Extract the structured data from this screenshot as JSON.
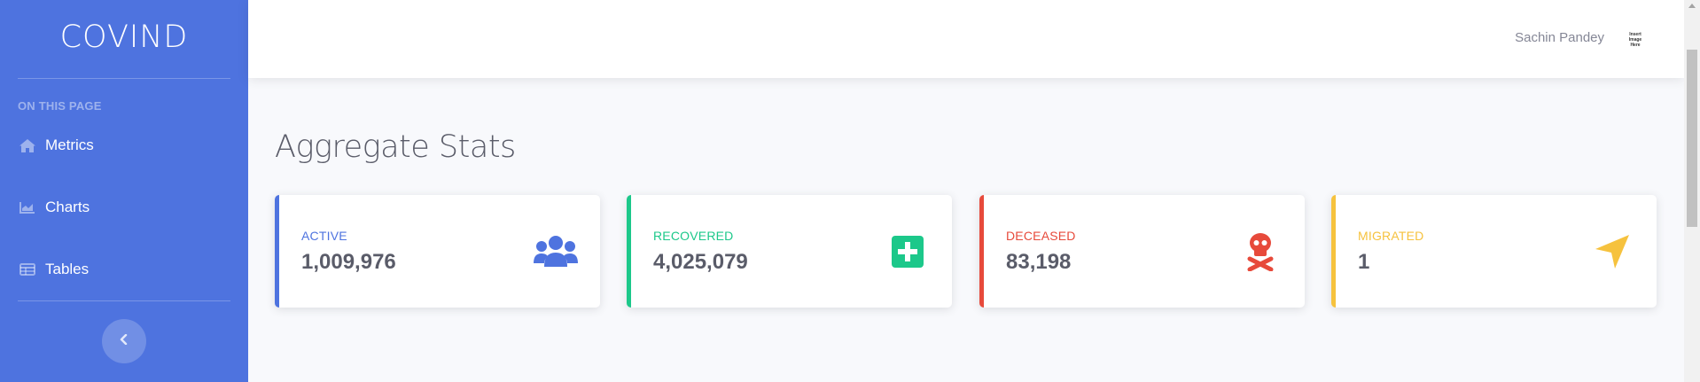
{
  "sidebar": {
    "brand": "COVIND",
    "section_heading": "ON THIS PAGE",
    "items": [
      {
        "label": "Metrics",
        "icon": "home-icon"
      },
      {
        "label": "Charts",
        "icon": "area-chart-icon"
      },
      {
        "label": "Tables",
        "icon": "table-icon"
      }
    ],
    "toggle_icon": "chevron-left-icon",
    "background_color": "#4e73df"
  },
  "topbar": {
    "user_name": "Sachin Pandey",
    "avatar_text": [
      "Insert",
      "Image",
      "Here"
    ]
  },
  "main": {
    "page_title": "Aggregate Stats",
    "cards": [
      {
        "label": "ACTIVE",
        "value": "1,009,976",
        "color": "#4e73df",
        "icon": "users-icon"
      },
      {
        "label": "RECOVERED",
        "value": "4,025,079",
        "color": "#1cc88a",
        "icon": "plus-square-icon"
      },
      {
        "label": "DECEASED",
        "value": "83,198",
        "color": "#e74a3b",
        "icon": "skull-crossbones-icon"
      },
      {
        "label": "MIGRATED",
        "value": "1",
        "color": "#f6c23e",
        "icon": "location-arrow-icon"
      }
    ]
  }
}
